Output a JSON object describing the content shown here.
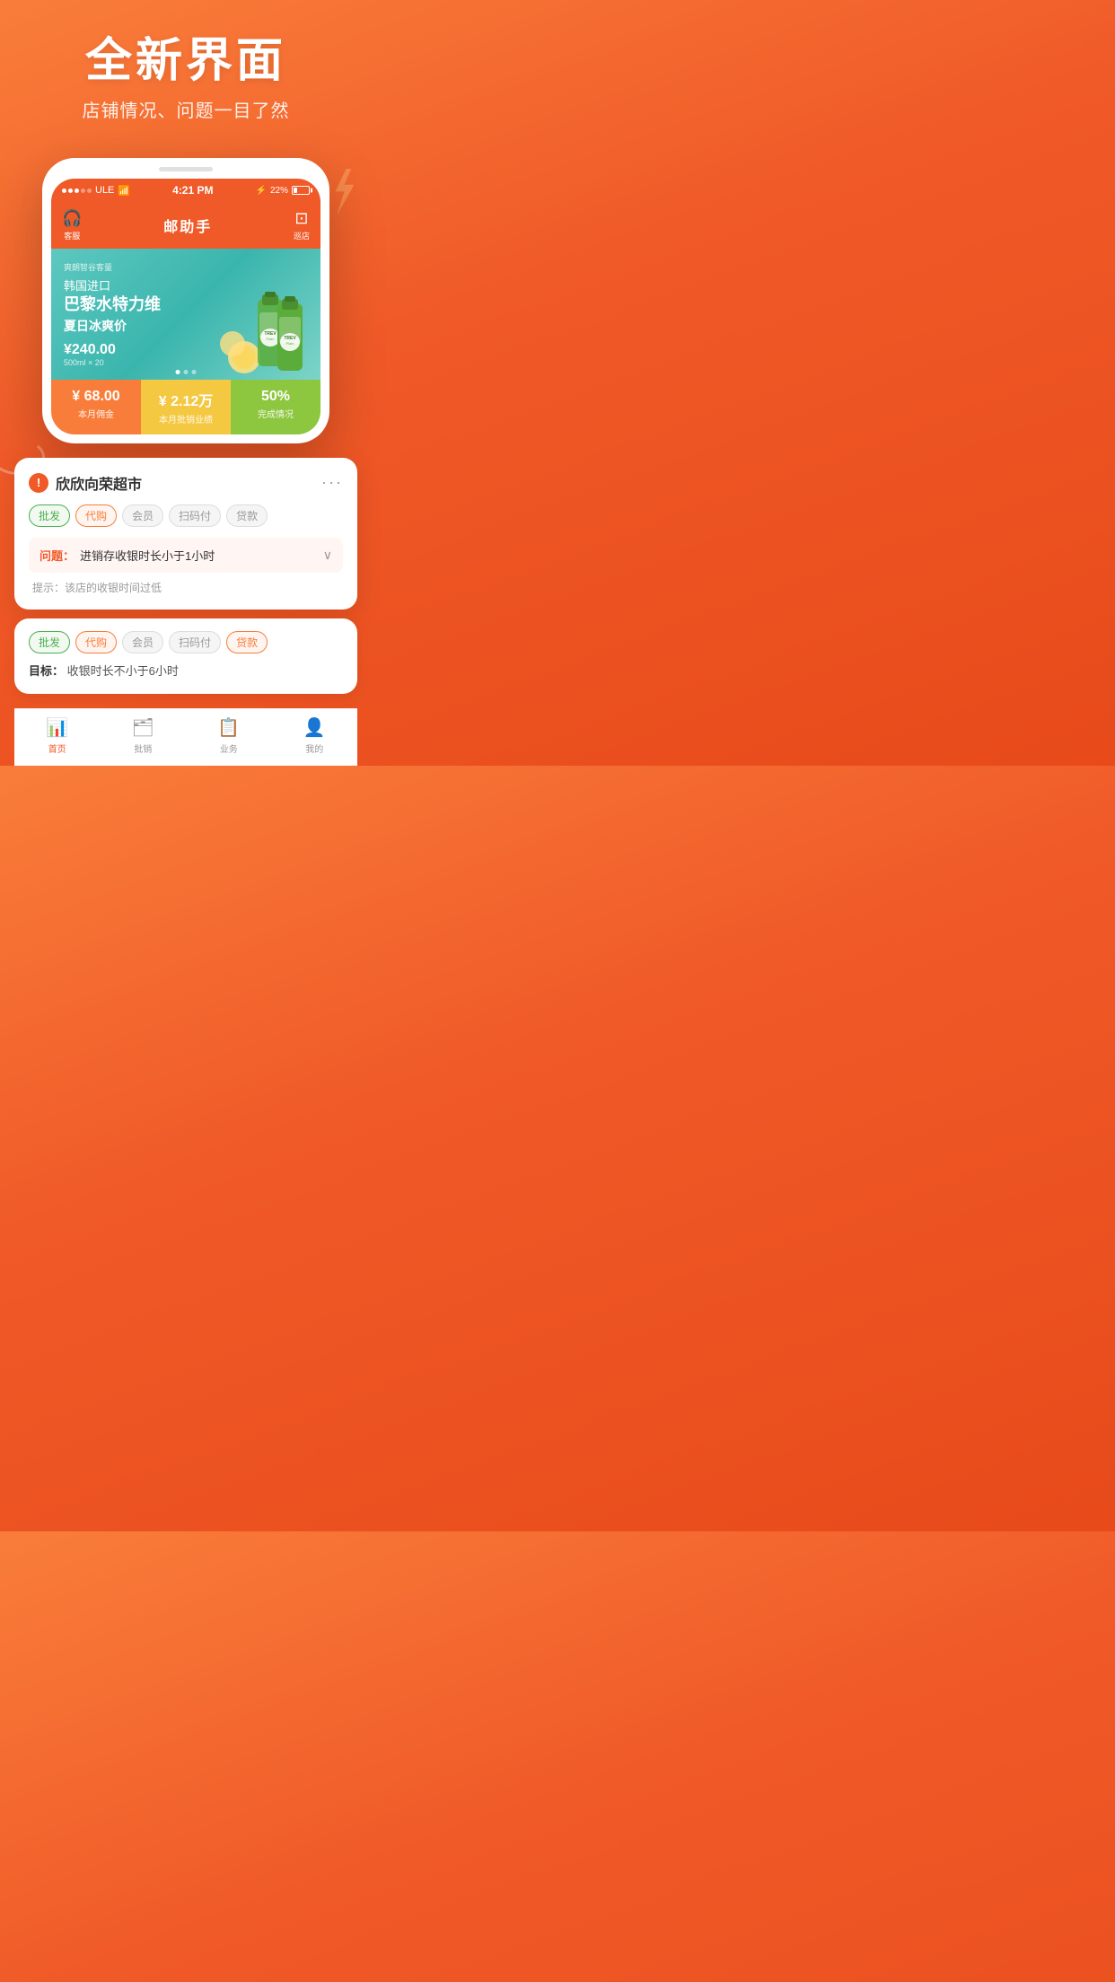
{
  "header": {
    "title": "全新界面",
    "subtitle": "店铺情况、问题一目了然"
  },
  "statusBar": {
    "carrier": "ULE",
    "time": "4:21 PM",
    "battery": "22%"
  },
  "appHeader": {
    "leftIcon": "headset",
    "leftLabel": "客服",
    "title": "邮助手",
    "rightLabel": "巡店"
  },
  "banner": {
    "smallText": "爽朗智谷客量",
    "titleCn": "韩国进口",
    "product": "巴黎水特力维",
    "subtitle": "夏日冰爽价",
    "price": "¥240.00",
    "priceUnit": "500ml × 20"
  },
  "stats": [
    {
      "amount": "¥ 68.00",
      "label": "本月佣金"
    },
    {
      "amount": "¥ 2.12万",
      "label": "本月批销业绩"
    },
    {
      "amount": "50%",
      "label": "完成情况"
    }
  ],
  "storeCard": {
    "storeName": "欣欣向荣超市",
    "tags": [
      {
        "text": "批发",
        "type": "green"
      },
      {
        "text": "代购",
        "type": "orange"
      },
      {
        "text": "会员",
        "type": "gray"
      },
      {
        "text": "扫码付",
        "type": "gray"
      },
      {
        "text": "贷款",
        "type": "gray"
      }
    ],
    "problemLabel": "问题：",
    "problemText": "进销存收银时长小于1小时",
    "hint": "提示：该店的收银时间过低"
  },
  "secondSnippet": {
    "tags": [
      {
        "text": "批发",
        "type": "green"
      },
      {
        "text": "代购",
        "type": "orange"
      },
      {
        "text": "会员",
        "type": "gray"
      },
      {
        "text": "扫码付",
        "type": "gray"
      },
      {
        "text": "贷款",
        "type": "orange"
      }
    ],
    "goalLabel": "目标：",
    "goalText": "收银时长不小于6小时"
  },
  "tabBar": {
    "items": [
      {
        "icon": "📊",
        "label": "首页",
        "active": true
      },
      {
        "icon": "🗂",
        "label": "批销",
        "active": false
      },
      {
        "icon": "📋",
        "label": "业务",
        "active": false
      },
      {
        "icon": "👤",
        "label": "我的",
        "active": false
      }
    ]
  }
}
